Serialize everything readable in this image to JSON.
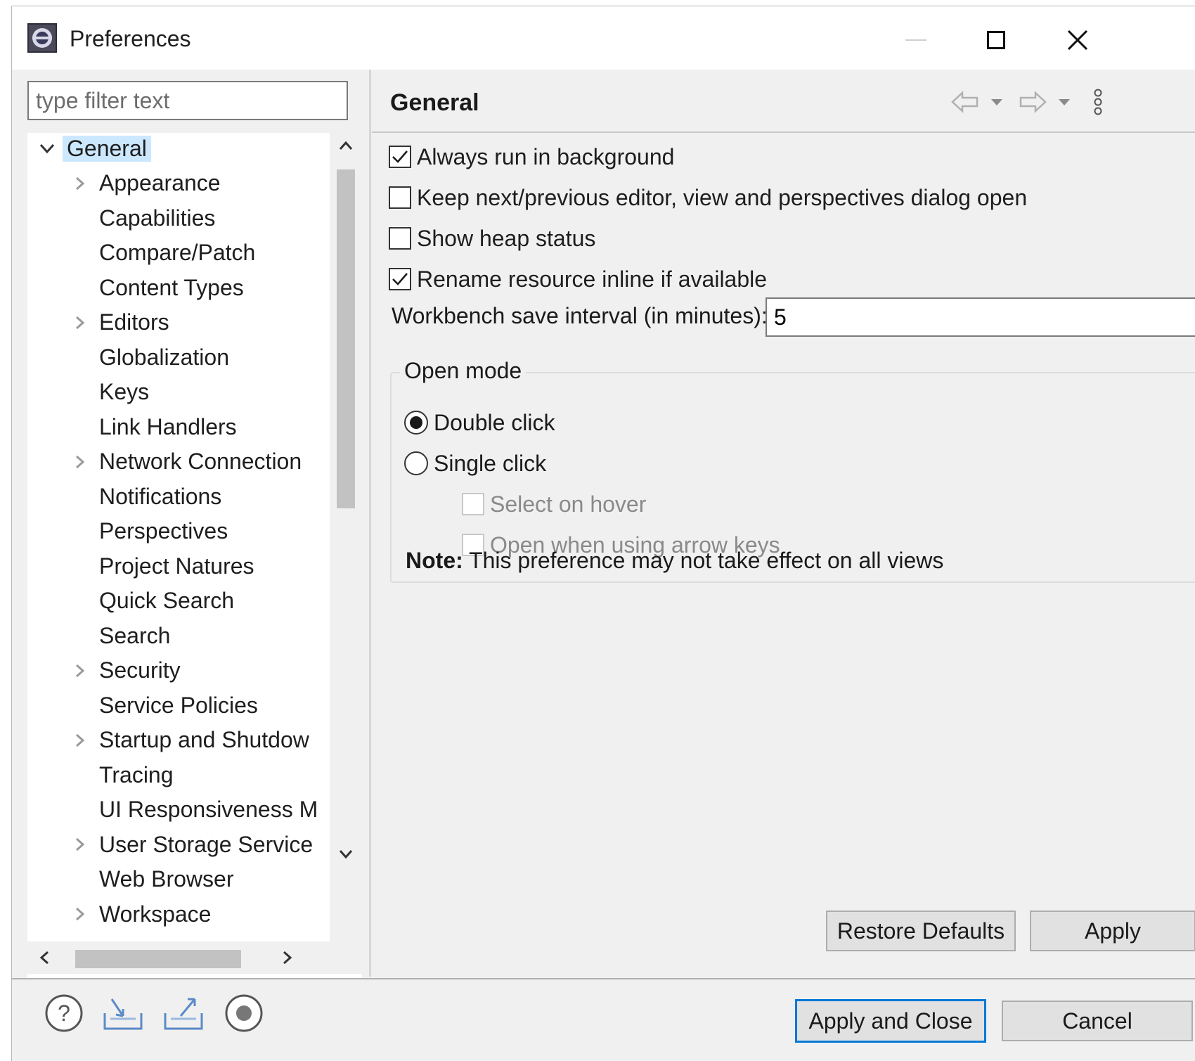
{
  "window": {
    "title": "Preferences",
    "minimize_icon": "minimize-icon",
    "maximize_icon": "maximize-icon",
    "close_icon": "close-icon"
  },
  "filter": {
    "placeholder": "type filter text",
    "value": ""
  },
  "tree": {
    "items": [
      {
        "label": "General",
        "level": 0,
        "expander": "expanded",
        "selected": true
      },
      {
        "label": "Appearance",
        "level": 1,
        "expander": "collapsed"
      },
      {
        "label": "Capabilities",
        "level": 1,
        "expander": "none"
      },
      {
        "label": "Compare/Patch",
        "level": 1,
        "expander": "none"
      },
      {
        "label": "Content Types",
        "level": 1,
        "expander": "none"
      },
      {
        "label": "Editors",
        "level": 1,
        "expander": "collapsed"
      },
      {
        "label": "Globalization",
        "level": 1,
        "expander": "none"
      },
      {
        "label": "Keys",
        "level": 1,
        "expander": "none"
      },
      {
        "label": "Link Handlers",
        "level": 1,
        "expander": "none"
      },
      {
        "label": "Network Connection",
        "level": 1,
        "expander": "collapsed"
      },
      {
        "label": "Notifications",
        "level": 1,
        "expander": "none"
      },
      {
        "label": "Perspectives",
        "level": 1,
        "expander": "none"
      },
      {
        "label": "Project Natures",
        "level": 1,
        "expander": "none"
      },
      {
        "label": "Quick Search",
        "level": 1,
        "expander": "none"
      },
      {
        "label": "Search",
        "level": 1,
        "expander": "none"
      },
      {
        "label": "Security",
        "level": 1,
        "expander": "collapsed"
      },
      {
        "label": "Service Policies",
        "level": 1,
        "expander": "none"
      },
      {
        "label": "Startup and Shutdow",
        "level": 1,
        "expander": "collapsed"
      },
      {
        "label": "Tracing",
        "level": 1,
        "expander": "none"
      },
      {
        "label": "UI Responsiveness M",
        "level": 1,
        "expander": "none"
      },
      {
        "label": "User Storage Service",
        "level": 1,
        "expander": "collapsed"
      },
      {
        "label": "Web Browser",
        "level": 1,
        "expander": "none"
      },
      {
        "label": "Workspace",
        "level": 1,
        "expander": "collapsed"
      }
    ]
  },
  "page": {
    "title": "General",
    "icons": [
      "back-arrow-icon",
      "back-dropdown-icon",
      "forward-arrow-icon",
      "forward-dropdown-icon",
      "view-menu-icon"
    ],
    "options": [
      {
        "label": "Always run in background",
        "checked": true,
        "enabled": true
      },
      {
        "label": "Keep next/previous editor, view and perspectives dialog open",
        "checked": false,
        "enabled": true
      },
      {
        "label": "Show heap status",
        "checked": false,
        "enabled": true
      },
      {
        "label": "Rename resource inline if available",
        "checked": true,
        "enabled": true
      }
    ],
    "save_interval": {
      "label": "Workbench save interval (in minutes):",
      "value": "5"
    },
    "open_mode": {
      "label": "Open mode",
      "double_click": {
        "label": "Double click",
        "selected": true
      },
      "single_click": {
        "label": "Single click",
        "selected": false
      },
      "select_on_hover": {
        "label": "Select on hover",
        "checked": false,
        "enabled": false
      },
      "open_arrow_keys": {
        "label": "Open when using arrow keys",
        "checked": false,
        "enabled": false
      }
    },
    "note": {
      "bold": "Note:",
      "text": " This preference may not take effect on all views"
    },
    "restore_defaults_label": "Restore Defaults",
    "apply_label": "Apply"
  },
  "footer": {
    "icons": [
      "help-icon",
      "import-icon",
      "export-icon",
      "record-icon"
    ],
    "apply_close_label": "Apply and Close",
    "cancel_label": "Cancel"
  },
  "colors": {
    "selection": "#cce8ff",
    "default_button_border": "#0078d7",
    "dialog_bg": "#f0f0f0"
  }
}
